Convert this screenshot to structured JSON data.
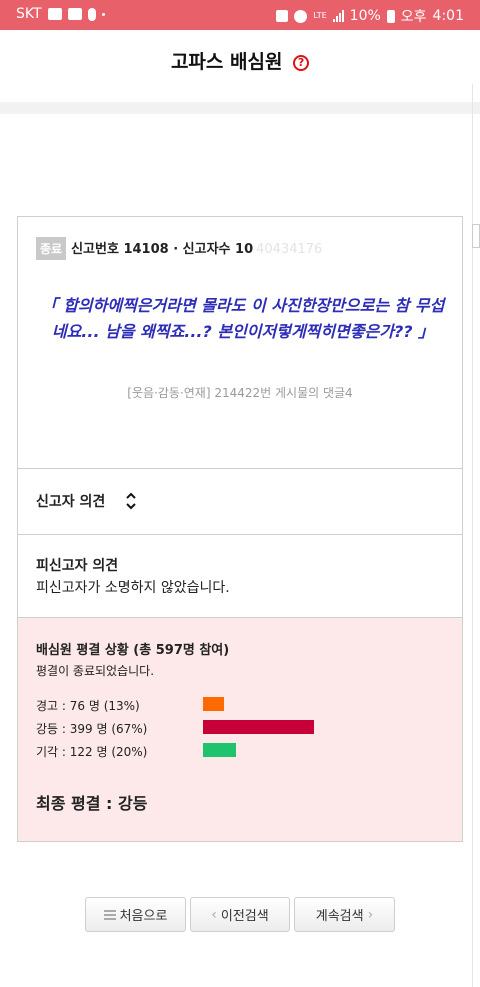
{
  "status_bar": {
    "carrier": "SKT",
    "battery": "10%",
    "ampm": "오후",
    "time": "4:01",
    "network": "LTE",
    "icons": [
      "gallery-icon",
      "youtube-icon",
      "mic-icon",
      "dot-icon",
      "mute-icon",
      "alarm-icon",
      "lte-icon",
      "signal-icon",
      "battery-icon"
    ]
  },
  "header": {
    "title": "고파스 배심원",
    "help_icon": "question-circle-icon",
    "help_glyph": "?"
  },
  "report": {
    "badge": "종료",
    "meta": "신고번호 14108 · 신고자수 10",
    "faded_id": "40434176",
    "quote": "「 합의하에찍은거라면 몰라도 이 사진한장만으로는 참 무섭네요... 남을 왜찍죠...? 본인이저렇게찍히면좋은가?? 」",
    "source": "[웃음·감동·연재] 214422번 게시물의 댓글4"
  },
  "reporter_opinion": {
    "label": "신고자 의견",
    "icon": "expand-toggle-icon"
  },
  "accused_opinion": {
    "label": "피신고자 의견",
    "text": "피신고자가 소명하지 않았습니다."
  },
  "verdict": {
    "title": "배심원 평결 상황 (총 597명 참여)",
    "status": "평결이 종료되었습니다.",
    "votes": [
      {
        "label": "경고 : 76 명 (13%)",
        "count": 76,
        "percent": 13,
        "color": "#ff6a00"
      },
      {
        "label": "강등 : 399 명 (67%)",
        "count": 399,
        "percent": 67,
        "color": "#c8003a"
      },
      {
        "label": "기각 : 122 명 (20%)",
        "count": 122,
        "percent": 20,
        "color": "#1dc36d"
      }
    ],
    "final": "최종 평결 : 강등"
  },
  "nav": {
    "first_label": "처음으로",
    "prev_label": "이전검색",
    "next_label": "계속검색",
    "prev_glyph": "‹",
    "next_glyph": "›"
  }
}
